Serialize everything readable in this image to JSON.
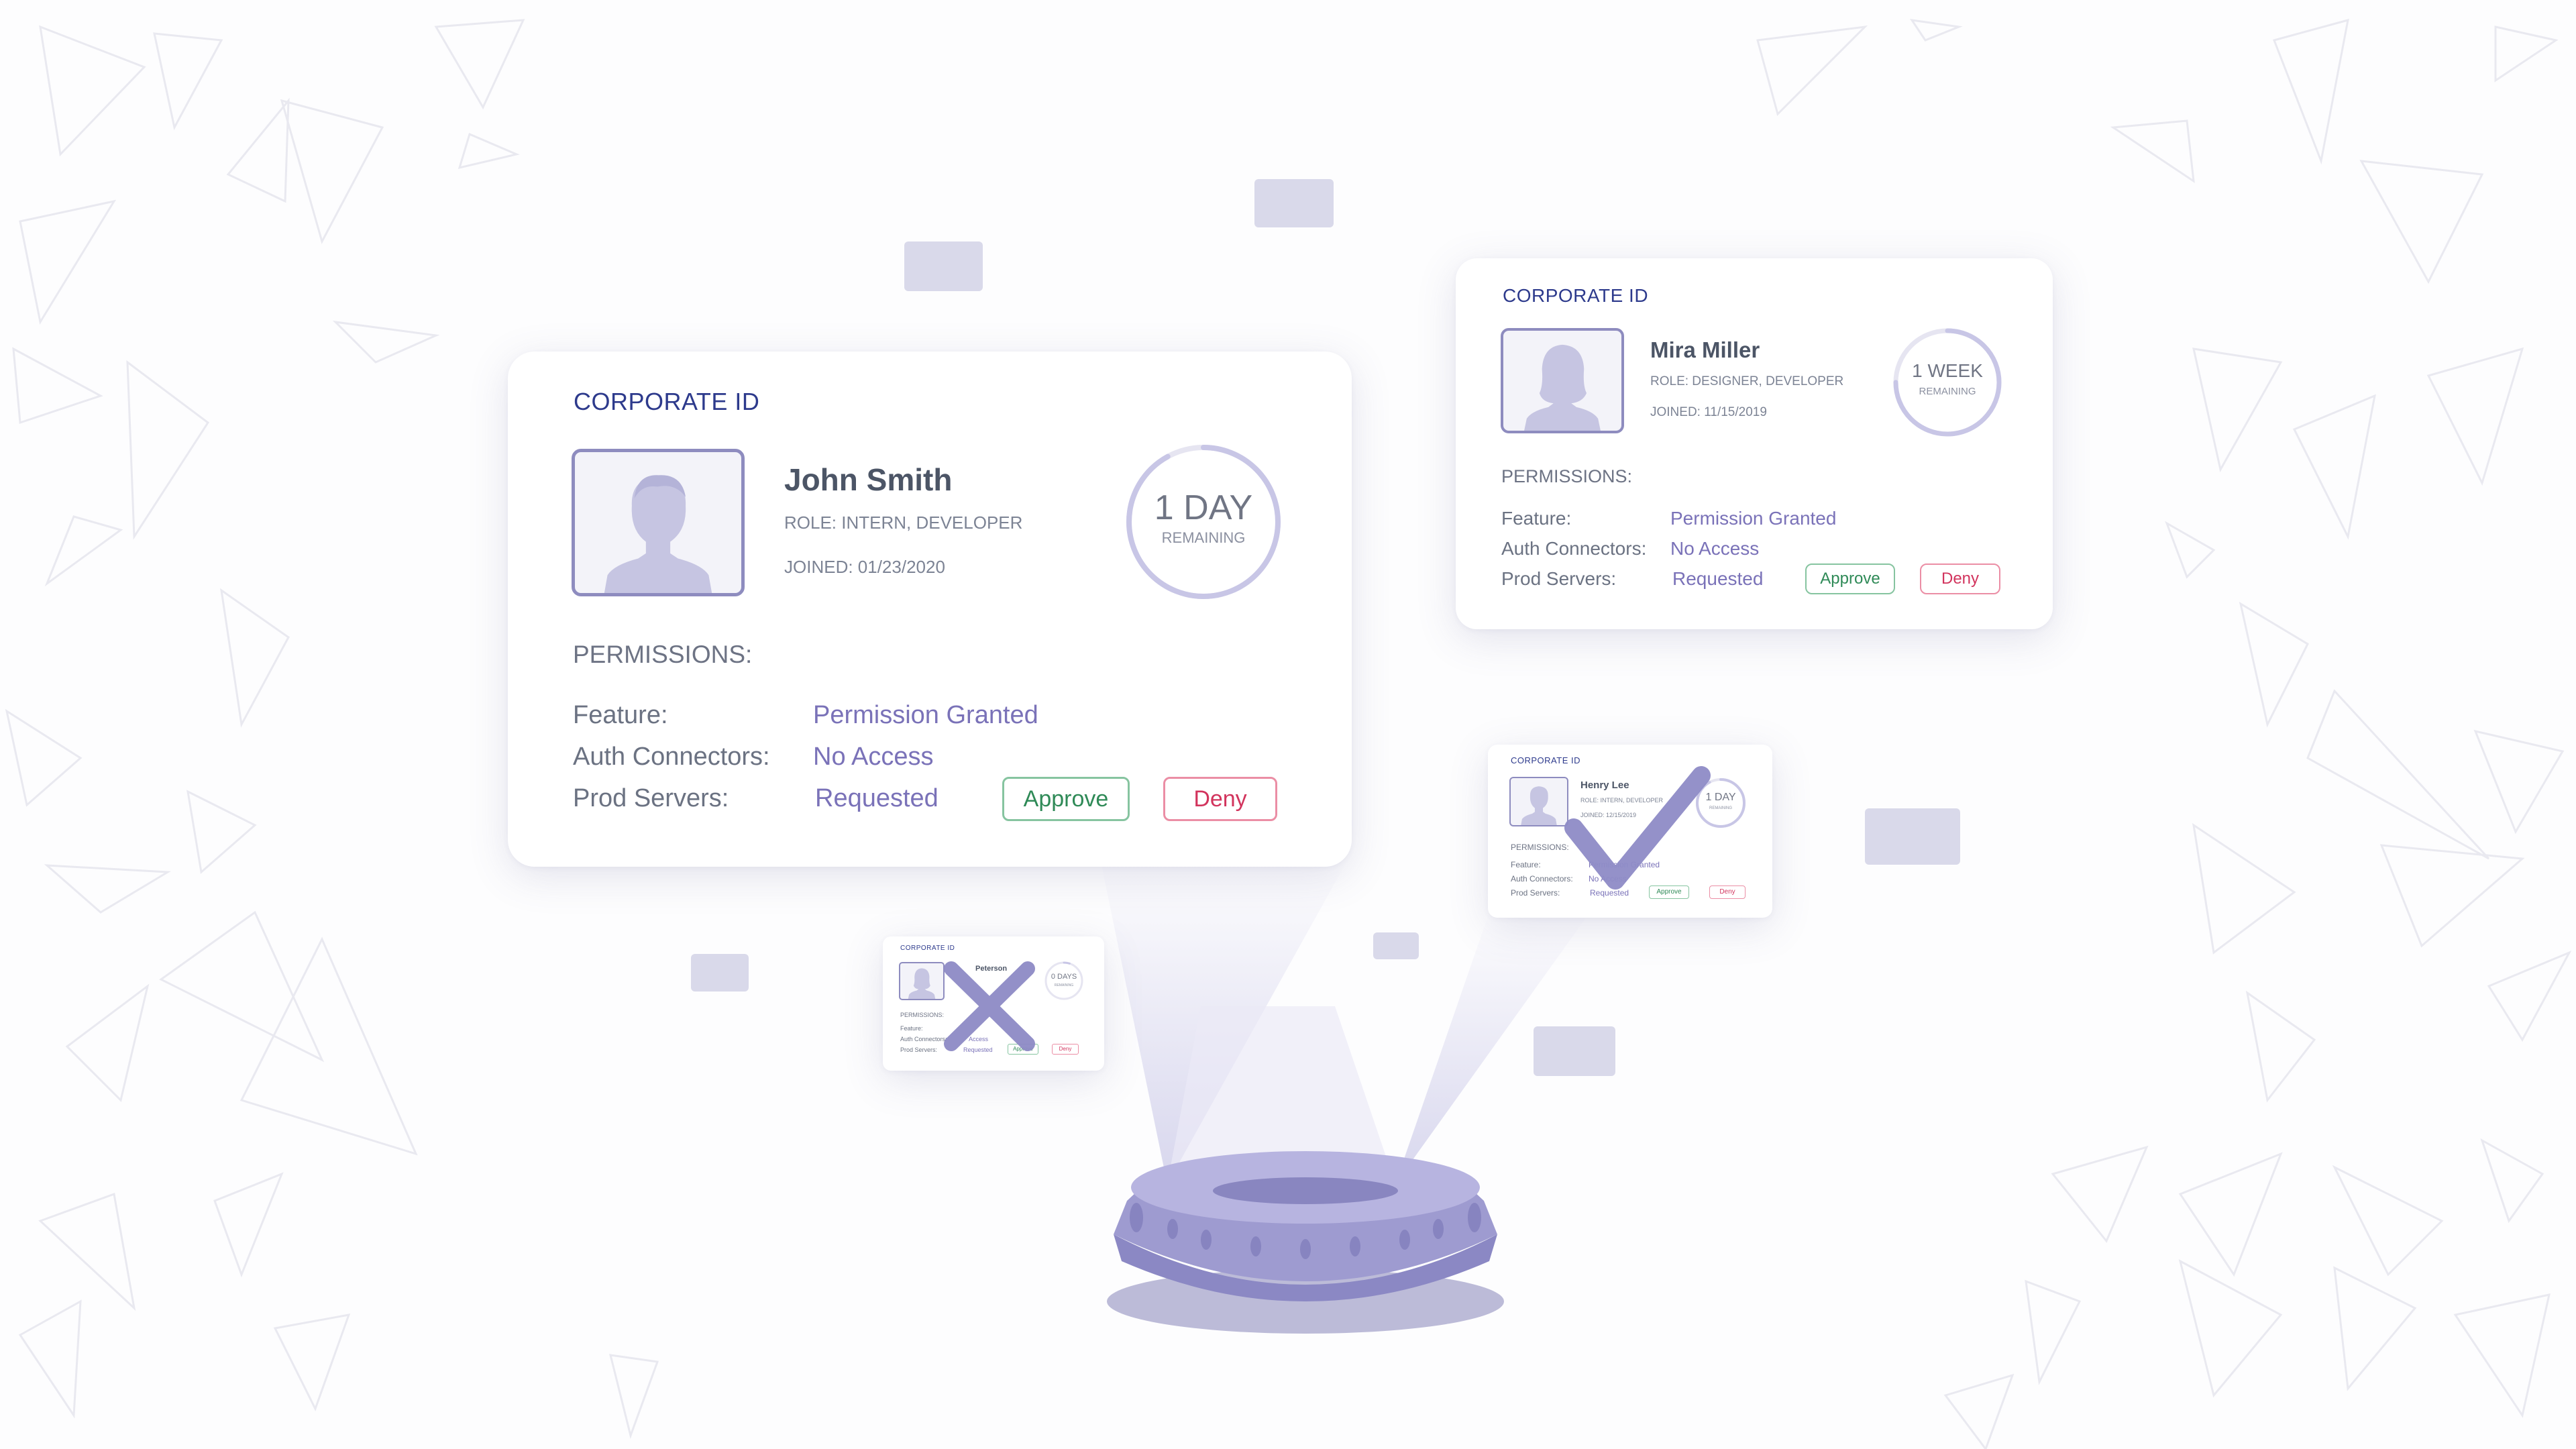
{
  "colors": {
    "background": "#fdfdfe",
    "card_title": "#2d3a8c",
    "accent_lavender": "#8e8cbf",
    "approve": "#2f8a57",
    "deny": "#d2345d",
    "projector": "#9e9bd0"
  },
  "main_card": {
    "title": "CORPORATE ID",
    "name": "John Smith",
    "role": "ROLE: INTERN, DEVELOPER",
    "joined": "JOINED: 01/23/2020",
    "countdown": {
      "value": "1 DAY",
      "label": "REMAINING",
      "progress": 0.92
    },
    "permissions_heading": "PERMISSIONS:",
    "permissions": [
      {
        "label": "Feature:",
        "value": "Permission Granted"
      },
      {
        "label": "Auth Connectors:",
        "value": "No Access"
      },
      {
        "label": "Prod Servers:",
        "value": "Requested"
      }
    ],
    "approve_label": "Approve",
    "deny_label": "Deny"
  },
  "second_card": {
    "title": "CORPORATE ID",
    "name": "Mira Miller",
    "role": "ROLE: DESIGNER, DEVELOPER",
    "joined": "JOINED: 11/15/2019",
    "countdown": {
      "value": "1 WEEK",
      "label": "REMAINING",
      "progress": 0.75
    },
    "permissions_heading": "PERMISSIONS:",
    "permissions": [
      {
        "label": "Feature:",
        "value": "Permission Granted"
      },
      {
        "label": "Auth Connectors:",
        "value": "No Access"
      },
      {
        "label": "Prod Servers:",
        "value": "Requested"
      }
    ],
    "approve_label": "Approve",
    "deny_label": "Deny"
  },
  "approved_card": {
    "title": "CORPORATE ID",
    "name": "Henry Lee",
    "role": "ROLE: INTERN, DEVELOPER",
    "joined": "JOINED: 12/15/2019",
    "countdown": {
      "value": "1 DAY",
      "label": "REMAINING",
      "progress": 0.92
    },
    "permissions_heading": "PERMISSIONS:",
    "permissions": [
      {
        "label": "Feature:",
        "value": "Permission Granted"
      },
      {
        "label": "Auth Connectors:",
        "value": "No Access"
      },
      {
        "label": "Prod Servers:",
        "value": "Requested"
      }
    ],
    "approve_label": "Approve",
    "deny_label": "Deny",
    "status_icon": "checkmark-icon"
  },
  "denied_card": {
    "title": "CORPORATE ID",
    "name": "Peterson",
    "countdown": {
      "value": "0 DAYS",
      "label": "REMAINING",
      "progress": 0.05
    },
    "permissions_heading": "PERMISSIONS:",
    "permissions": [
      {
        "label": "Feature:",
        "value": ""
      },
      {
        "label": "Auth Connectors:",
        "value": "Access"
      },
      {
        "label": "Prod Servers:",
        "value": "Requested"
      }
    ],
    "approve_label": "Approve",
    "deny_label": "Deny",
    "status_icon": "x-mark-icon"
  }
}
